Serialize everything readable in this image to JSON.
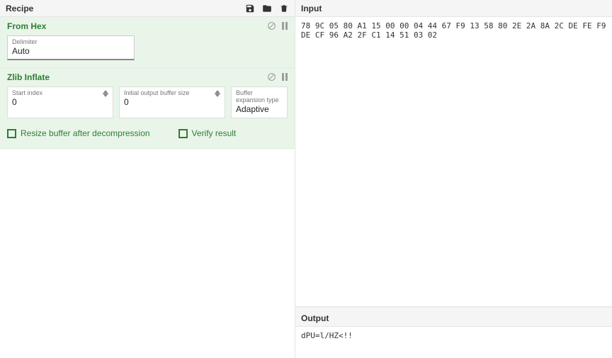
{
  "recipe": {
    "title": "Recipe",
    "icons": {
      "save": "save-icon",
      "open": "folder-icon",
      "clear": "trash-icon"
    }
  },
  "ops": {
    "fromHex": {
      "title": "From Hex",
      "disableTip": "Disable operation",
      "pauseTip": "Pause",
      "delimiter": {
        "label": "Delimiter",
        "value": "Auto"
      }
    },
    "zlibInflate": {
      "title": "Zlib Inflate",
      "disableTip": "Disable operation",
      "pauseTip": "Pause",
      "startIndex": {
        "label": "Start index",
        "value": "0"
      },
      "initBuf": {
        "label": "Initial output buffer size",
        "value": "0"
      },
      "expType": {
        "label": "Buffer expansion type",
        "value": "Adaptive"
      },
      "resizeLabel": "Resize buffer after decompression",
      "verifyLabel": "Verify result"
    }
  },
  "io": {
    "inputTitle": "Input",
    "inputText": "78 9C 05 80 A1 15 00 00 04 44 67 F9 13 58 80 2E 2A 8A 2C DE FE F9 DE CF 96 A2 2F C1 14 51 03 02",
    "outputTitle": "Output",
    "outputText": "dPU=l/HZ<!!"
  }
}
